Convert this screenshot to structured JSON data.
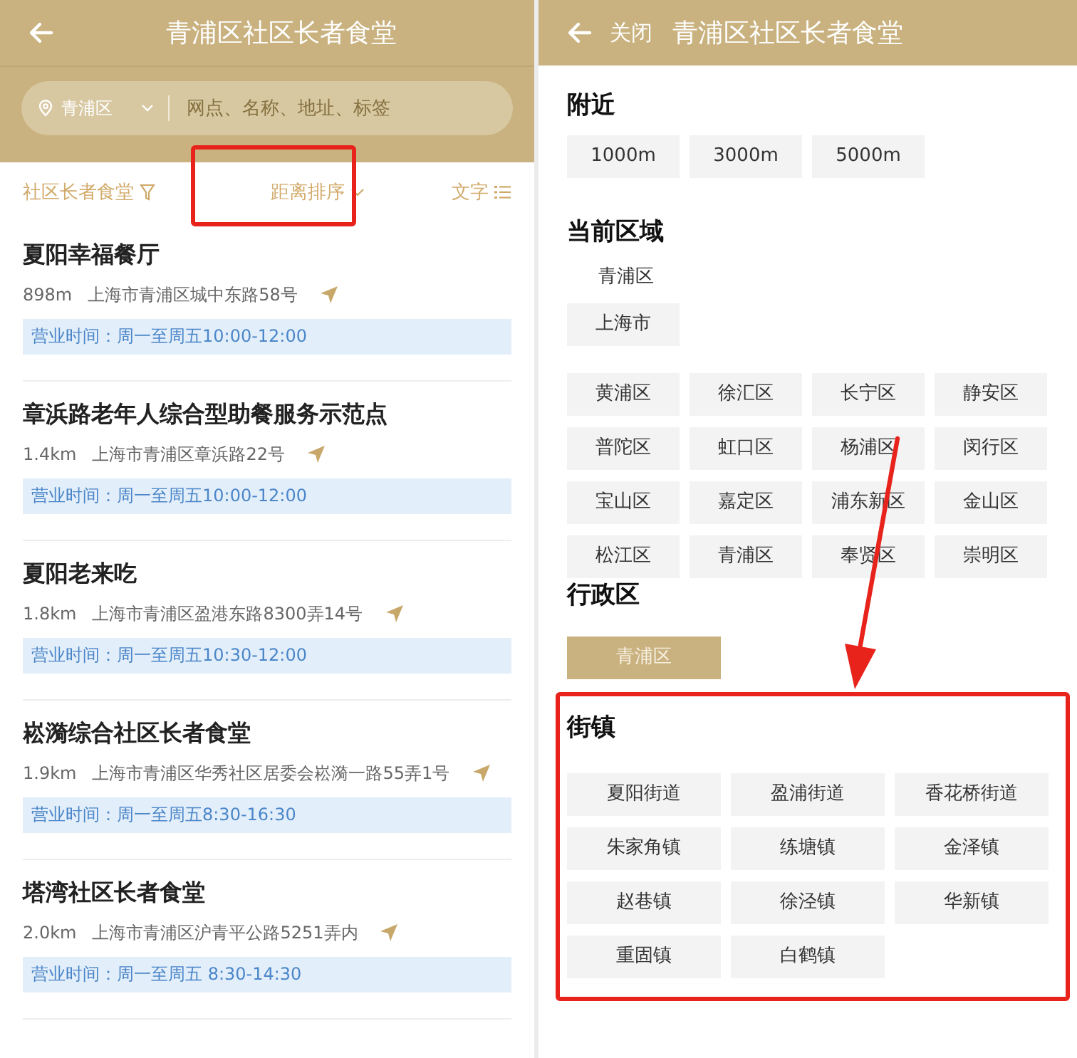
{
  "left": {
    "header": {
      "title": "青浦区社区长者食堂"
    },
    "search": {
      "region": "青浦区",
      "placeholder": "网点、名称、地址、标签"
    },
    "filters": [
      {
        "kind": "filter",
        "label": "社区长者食堂",
        "highlighted": false
      },
      {
        "kind": "sort",
        "label": "距离排序",
        "highlighted": true
      },
      {
        "kind": "view",
        "label": "文字",
        "highlighted": false
      }
    ],
    "places": [
      {
        "name": "夏阳幸福餐厅",
        "distance": "898m",
        "address": "上海市青浦区城中东路58号",
        "hours": "营业时间：周一至周五10:00-12:00"
      },
      {
        "name": "章浜路老年人综合型助餐服务示范点",
        "distance": "1.4km",
        "address": "上海市青浦区章浜路22号",
        "hours": "营业时间：周一至周五10:00-12:00"
      },
      {
        "name": "夏阳老来吃",
        "distance": "1.8km",
        "address": "上海市青浦区盈港东路8300弄14号",
        "hours": "营业时间：周一至周五10:30-12:00"
      },
      {
        "name": "崧漪综合社区长者食堂",
        "distance": "1.9km",
        "address": "上海市青浦区华秀社区居委会崧漪一路55弄1号",
        "hours": "营业时间：周一至周五8:30-16:30"
      },
      {
        "name": "塔湾社区长者食堂",
        "distance": "2.0km",
        "address": "上海市青浦区沪青平公路5251弄内",
        "hours": "营业时间：周一至周五 8:30-14:30"
      }
    ]
  },
  "right": {
    "header": {
      "close": "关闭",
      "title": "青浦区社区长者食堂"
    },
    "nearby": {
      "title": "附近",
      "options": [
        "1000m",
        "3000m",
        "5000m"
      ]
    },
    "current_area": {
      "title": "当前区域",
      "area": "青浦区",
      "city": "上海市",
      "districts": [
        "黄浦区",
        "徐汇区",
        "长宁区",
        "静安区",
        "普陀区",
        "虹口区",
        "杨浦区",
        "闵行区",
        "宝山区",
        "嘉定区",
        "浦东新区",
        "金山区",
        "松江区",
        "青浦区",
        "奉贤区",
        "崇明区"
      ]
    },
    "admin_district": {
      "title": "行政区",
      "options": [
        {
          "label": "青浦区",
          "selected": true
        }
      ]
    },
    "towns": {
      "title": "街镇",
      "highlighted": true,
      "options": [
        "夏阳街道",
        "盈浦街道",
        "香花桥街道",
        "朱家角镇",
        "练塘镇",
        "金泽镇",
        "赵巷镇",
        "徐泾镇",
        "华新镇",
        "重固镇",
        "白鹤镇"
      ]
    }
  }
}
